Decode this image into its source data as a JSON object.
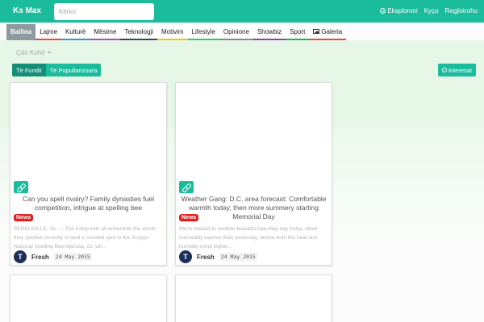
{
  "brand": "Ks Max",
  "search": {
    "placeholder": "Kërko"
  },
  "topnav": {
    "explore": "Eksploroni",
    "login": "Kyçu",
    "register": "Regjistrohu"
  },
  "nav": [
    {
      "label": "Ballina",
      "color": "#8e9aa0"
    },
    {
      "label": "Lajme",
      "color": "#e74c3c"
    },
    {
      "label": "Kulturë",
      "color": "#3498db"
    },
    {
      "label": "Mësime",
      "color": "#9b59b6"
    },
    {
      "label": "Teknologji",
      "color": "#34495e"
    },
    {
      "label": "Motivim",
      "color": "#f1c40f"
    },
    {
      "label": "Lifestyle",
      "color": "#2ecc71"
    },
    {
      "label": "Opinione",
      "color": "#7f8c8d"
    },
    {
      "label": "Showbiz",
      "color": "#8e44ad"
    },
    {
      "label": "Sport",
      "color": "#27ae60"
    },
    {
      "label": "Galeria",
      "color": "#e74c3c"
    }
  ],
  "filter": {
    "label": "Çdo Kohë"
  },
  "tabs": {
    "latest": "Të Fundit",
    "popular": "Të Popullarizuara"
  },
  "interest": "Interesat",
  "cards": [
    {
      "title": "Can you spell rivalry? Family dynasties fuel competition, intrigue at spelling bee",
      "badge": "News",
      "excerpt": "BERKLIVILLE, Va. — The Estep kids all remember the words they spelled correctly to land a coveted spot in the Scripps National Spelling Bee.Marissa, 22, wh...",
      "author": "Fresh",
      "date": "24 May 2015"
    },
    {
      "title": "Weather Gang: D.C. area forecast: Comfortable warmth today, then more summery starting Memorial Day",
      "badge": "News",
      "excerpt": "We're treated to another beautiful late-May day today, albeit noticeably warmer than yesterday, before both the heat and humidity trend higher...",
      "author": "Fresh",
      "date": "24 May 2015"
    }
  ],
  "colors": {
    "accent": "#1abc9c",
    "badge": "#e02020"
  }
}
